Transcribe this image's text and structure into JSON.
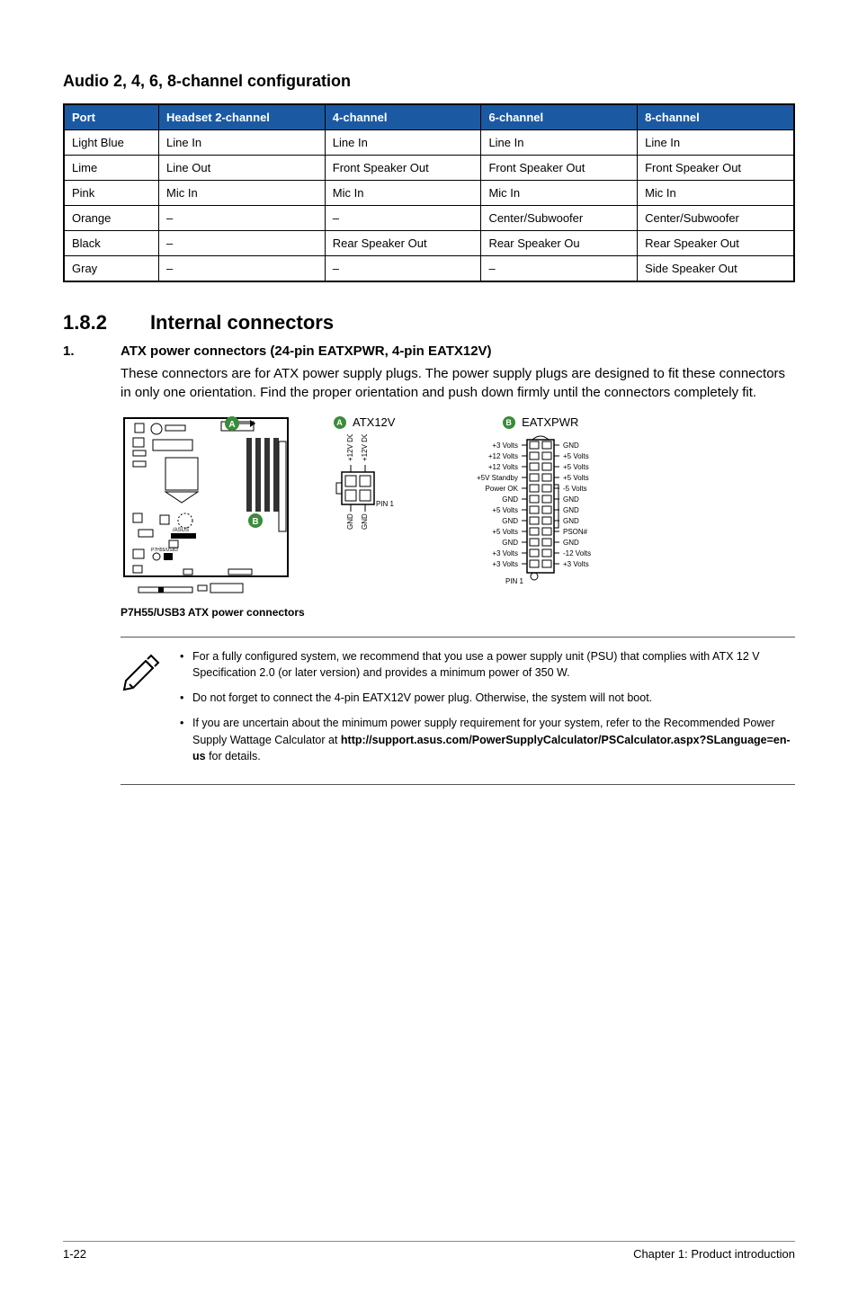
{
  "audio_title": "Audio 2, 4, 6, 8-channel configuration",
  "audio_table": {
    "headers": [
      "Port",
      "Headset 2-channel",
      "4-channel",
      "6-channel",
      "8-channel"
    ],
    "rows": [
      [
        "Light Blue",
        "Line In",
        "Line In",
        "Line In",
        "Line In"
      ],
      [
        "Lime",
        "Line Out",
        "Front Speaker Out",
        "Front Speaker Out",
        "Front Speaker Out"
      ],
      [
        "Pink",
        "Mic In",
        "Mic In",
        "Mic In",
        "Mic In"
      ],
      [
        "Orange",
        "–",
        "–",
        "Center/Subwoofer",
        "Center/Subwoofer"
      ],
      [
        "Black",
        "–",
        "Rear Speaker Out",
        "Rear Speaker Ou",
        "Rear Speaker Out"
      ],
      [
        "Gray",
        "–",
        "–",
        "–",
        "Side Speaker Out"
      ]
    ]
  },
  "section": {
    "num": "1.8.2",
    "title": "Internal connectors"
  },
  "item1": {
    "num": "1.",
    "title": "ATX power connectors (24-pin EATXPWR, 4-pin EATX12V)",
    "body": "These connectors are for ATX power supply plugs. The power supply plugs are designed to fit these connectors in only one orientation. Find the proper orientation and push down firmly until the connectors completely fit."
  },
  "diagram": {
    "atx12v_label": "ATX12V",
    "eatxpwr_label": "EATXPWR",
    "caption": "P7H55/USB3 ATX power connectors",
    "atx12v_pins_top": [
      "+12V DC",
      "+12V DC"
    ],
    "atx12v_pins_bot": [
      "GND",
      "GND"
    ],
    "pin1": "PIN 1",
    "eatx_left": [
      "+3 Volts",
      "+12 Volts",
      "+12 Volts",
      "+5V Standby",
      "Power OK",
      "GND",
      "+5 Volts",
      "GND",
      "+5 Volts",
      "GND",
      "+3 Volts",
      "+3 Volts"
    ],
    "eatx_right": [
      "GND",
      "+5 Volts",
      "+5 Volts",
      "+5 Volts",
      "-5 Volts",
      "GND",
      "GND",
      "GND",
      "PSON#",
      "GND",
      "-12 Volts",
      "+3 Volts"
    ],
    "marker_a": "A",
    "marker_b": "B"
  },
  "notes": [
    {
      "pre": "For a fully configured system, we recommend that you use a power supply unit (PSU) that complies with ATX 12 V Specification 2.0 (or later version) and provides a minimum power of 350 W."
    },
    {
      "pre": "Do not forget to connect the 4-pin EATX12V power plug. Otherwise, the system will not boot."
    },
    {
      "pre": "If you are uncertain about the minimum power supply requirement for your system, refer to the Recommended Power Supply Wattage Calculator at ",
      "bold": "http://support.asus.com/PowerSupplyCalculator/PSCalculator.aspx?SLanguage=en-us",
      "post": " for details."
    }
  ],
  "footer": {
    "left": "1-22",
    "right": "Chapter 1: Product introduction"
  }
}
